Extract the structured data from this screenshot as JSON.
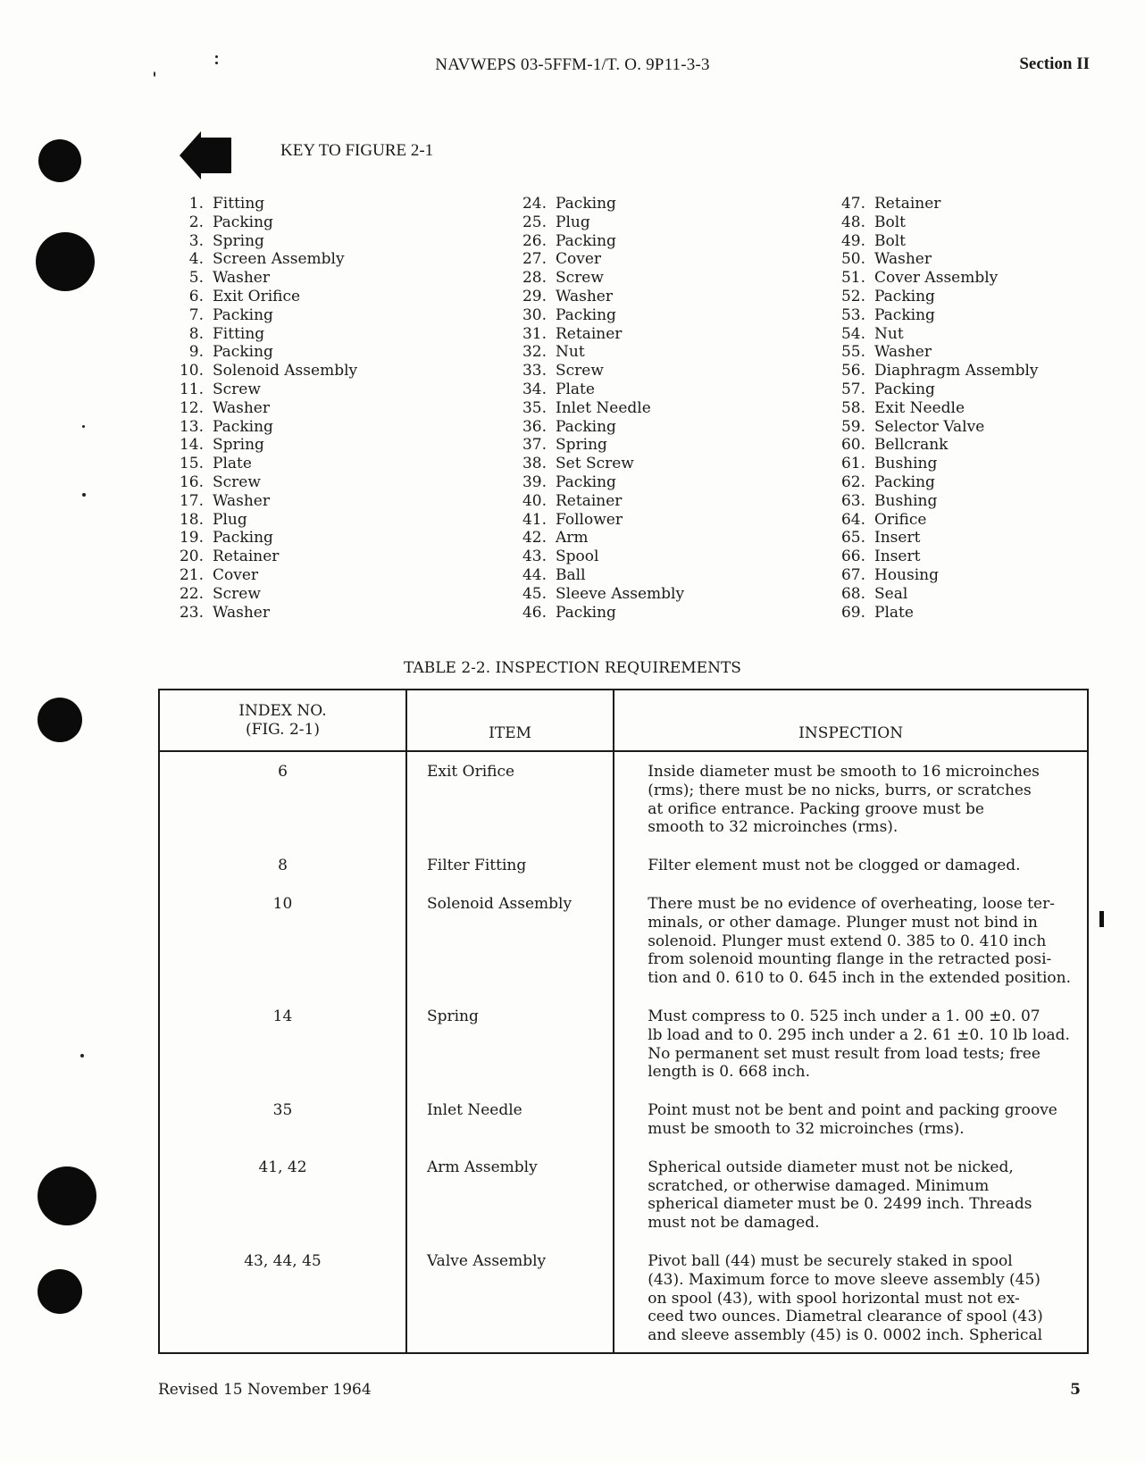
{
  "header": {
    "doc_number": "NAVWEPS 03-5FFM-1/T. O. 9P11-3-3",
    "section": "Section II"
  },
  "key": {
    "title": "KEY TO FIGURE 2-1",
    "arrow_icon": "left-arrow-icon",
    "columns": [
      [
        {
          "num": "1.",
          "label": "Fitting"
        },
        {
          "num": "2.",
          "label": "Packing"
        },
        {
          "num": "3.",
          "label": "Spring"
        },
        {
          "num": "4.",
          "label": "Screen Assembly"
        },
        {
          "num": "5.",
          "label": "Washer"
        },
        {
          "num": "6.",
          "label": "Exit Orifice"
        },
        {
          "num": "7.",
          "label": "Packing"
        },
        {
          "num": "8.",
          "label": "Fitting"
        },
        {
          "num": "9.",
          "label": "Packing"
        },
        {
          "num": "10.",
          "label": "Solenoid Assembly"
        },
        {
          "num": "11.",
          "label": "Screw"
        },
        {
          "num": "12.",
          "label": "Washer"
        },
        {
          "num": "13.",
          "label": "Packing"
        },
        {
          "num": "14.",
          "label": "Spring"
        },
        {
          "num": "15.",
          "label": "Plate"
        },
        {
          "num": "16.",
          "label": "Screw"
        },
        {
          "num": "17.",
          "label": "Washer"
        },
        {
          "num": "18.",
          "label": "Plug"
        },
        {
          "num": "19.",
          "label": "Packing"
        },
        {
          "num": "20.",
          "label": "Retainer"
        },
        {
          "num": "21.",
          "label": "Cover"
        },
        {
          "num": "22.",
          "label": "Screw"
        },
        {
          "num": "23.",
          "label": "Washer"
        }
      ],
      [
        {
          "num": "24.",
          "label": "Packing"
        },
        {
          "num": "25.",
          "label": "Plug"
        },
        {
          "num": "26.",
          "label": "Packing"
        },
        {
          "num": "27.",
          "label": "Cover"
        },
        {
          "num": "28.",
          "label": "Screw"
        },
        {
          "num": "29.",
          "label": "Washer"
        },
        {
          "num": "30.",
          "label": "Packing"
        },
        {
          "num": "31.",
          "label": "Retainer"
        },
        {
          "num": "32.",
          "label": "Nut"
        },
        {
          "num": "33.",
          "label": "Screw"
        },
        {
          "num": "34.",
          "label": "Plate"
        },
        {
          "num": "35.",
          "label": "Inlet Needle"
        },
        {
          "num": "36.",
          "label": "Packing"
        },
        {
          "num": "37.",
          "label": "Spring"
        },
        {
          "num": "38.",
          "label": "Set Screw"
        },
        {
          "num": "39.",
          "label": "Packing"
        },
        {
          "num": "40.",
          "label": "Retainer"
        },
        {
          "num": "41.",
          "label": "Follower"
        },
        {
          "num": "42.",
          "label": "Arm"
        },
        {
          "num": "43.",
          "label": "Spool"
        },
        {
          "num": "44.",
          "label": "Ball"
        },
        {
          "num": "45.",
          "label": "Sleeve Assembly"
        },
        {
          "num": "46.",
          "label": "Packing"
        }
      ],
      [
        {
          "num": "47.",
          "label": "Retainer"
        },
        {
          "num": "48.",
          "label": "Bolt"
        },
        {
          "num": "49.",
          "label": "Bolt"
        },
        {
          "num": "50.",
          "label": "Washer"
        },
        {
          "num": "51.",
          "label": "Cover Assembly"
        },
        {
          "num": "52.",
          "label": "Packing"
        },
        {
          "num": "53.",
          "label": "Packing"
        },
        {
          "num": "54.",
          "label": "Nut"
        },
        {
          "num": "55.",
          "label": "Washer"
        },
        {
          "num": "56.",
          "label": "Diaphragm Assembly"
        },
        {
          "num": "57.",
          "label": "Packing"
        },
        {
          "num": "58.",
          "label": "Exit Needle"
        },
        {
          "num": "59.",
          "label": "Selector Valve"
        },
        {
          "num": "60.",
          "label": "Bellcrank"
        },
        {
          "num": "61.",
          "label": "Bushing"
        },
        {
          "num": "62.",
          "label": "Packing"
        },
        {
          "num": "63.",
          "label": "Bushing"
        },
        {
          "num": "64.",
          "label": "Orifice"
        },
        {
          "num": "65.",
          "label": "Insert"
        },
        {
          "num": "66.",
          "label": "Insert"
        },
        {
          "num": "67.",
          "label": "Housing"
        },
        {
          "num": "68.",
          "label": "Seal"
        },
        {
          "num": "69.",
          "label": "Plate"
        }
      ]
    ]
  },
  "table": {
    "title": "TABLE 2-2.  INSPECTION REQUIREMENTS",
    "headers": {
      "index_line1": "INDEX NO.",
      "index_line2": "(FIG. 2-1)",
      "item": "ITEM",
      "inspection": "INSPECTION"
    },
    "rows": [
      {
        "index": "6",
        "item": "Exit Orifice",
        "inspection": [
          "Inside diameter must be smooth to 16 microinches",
          "(rms); there must be no nicks, burrs, or scratches",
          "at orifice entrance.  Packing groove must be",
          "smooth to 32 microinches (rms)."
        ]
      },
      {
        "index": "8",
        "item": "Filter Fitting",
        "inspection": [
          "Filter element must not be clogged or damaged."
        ]
      },
      {
        "index": "10",
        "item": "Solenoid Assembly",
        "inspection": [
          "There must be no evidence of overheating, loose ter-",
          "minals, or other damage.  Plunger must not bind in",
          "solenoid.  Plunger must extend 0. 385 to 0. 410 inch",
          "from solenoid mounting flange in the retracted posi-",
          "tion and 0. 610 to 0. 645 inch in the extended position."
        ]
      },
      {
        "index": "14",
        "item": "Spring",
        "inspection": [
          "Must compress to 0. 525 inch under a 1. 00 ±0. 07",
          "lb load and to 0. 295 inch under a 2. 61 ±0. 10 lb load.",
          "No permanent set must result from load tests; free",
          "length is 0. 668 inch."
        ]
      },
      {
        "index": "35",
        "item": "Inlet Needle",
        "inspection": [
          "Point must not be bent and point and packing groove",
          "must be smooth to 32 microinches (rms)."
        ]
      },
      {
        "index": "41, 42",
        "item": "Arm Assembly",
        "inspection": [
          "Spherical outside diameter must not be nicked,",
          "scratched, or otherwise damaged.  Minimum",
          "spherical diameter must be 0. 2499 inch.  Threads",
          "must not be damaged."
        ]
      },
      {
        "index": "43, 44, 45",
        "item": "Valve Assembly",
        "inspection": [
          "Pivot ball (44) must be securely staked in spool",
          "(43).  Maximum force to move sleeve assembly (45)",
          "on spool (43), with spool horizontal must not ex-",
          "ceed two ounces.  Diametral clearance of spool (43)",
          "and sleeve assembly (45) is 0. 0002 inch.  Spherical"
        ]
      }
    ]
  },
  "footer": {
    "revision": "Revised 15 November 1964",
    "page_number": "5"
  }
}
